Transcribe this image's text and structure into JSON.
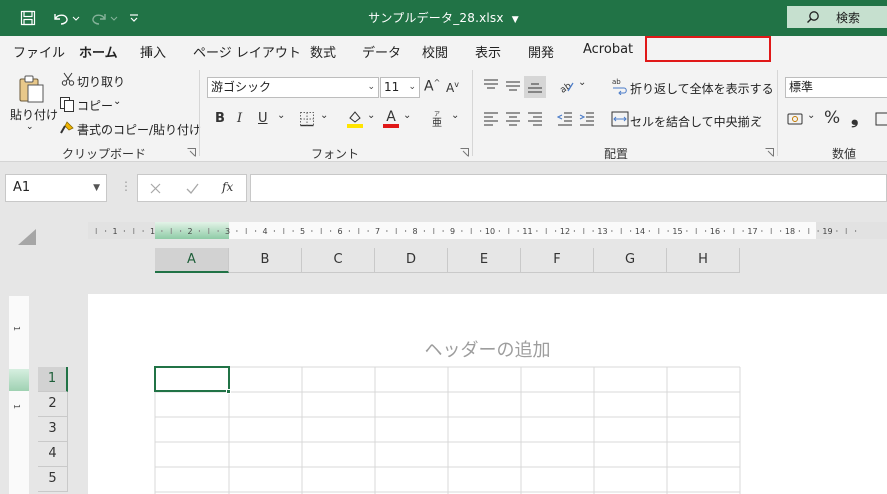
{
  "titlebar": {
    "title": "サンプルデータ_28.xlsx",
    "search_label": "検索"
  },
  "tabs": [
    "ファイル",
    "ホーム",
    "挿入",
    "ページ レイアウト",
    "数式",
    "データ",
    "校閲",
    "表示",
    "開発",
    "Acrobat"
  ],
  "active_tab": "ホーム",
  "clipboard": {
    "paste_label": "貼り付け",
    "cut_label": "切り取り",
    "copy_label": "コピー",
    "format_painter_label": "書式のコピー/貼り付け",
    "group_label": "クリップボード"
  },
  "font": {
    "font_name": "游ゴシック",
    "font_size": "11",
    "group_label": "フォント",
    "bold": "B",
    "italic": "I",
    "underline": "U",
    "font_color_glyph": "A"
  },
  "alignment": {
    "wrap_text_label": "折り返して全体を表示する",
    "merge_center_label": "セルを結合して中央揃え",
    "group_label": "配置"
  },
  "number": {
    "format_value": "標準",
    "group_label": "数値",
    "percent": "%"
  },
  "formula_bar": {
    "name_box": "A1",
    "fx": "fx",
    "content": ""
  },
  "columns": [
    "A",
    "B",
    "C",
    "D",
    "E",
    "F",
    "G",
    "H"
  ],
  "rows": [
    "1",
    "2",
    "3",
    "4",
    "5"
  ],
  "selected_cell": "A1",
  "page_header_placeholder": "ヘッダーの追加",
  "ruler_top_labels": [
    "1",
    "1",
    "2",
    "3",
    "4",
    "5",
    "6",
    "7",
    "8",
    "9",
    "10",
    "11",
    "12",
    "13",
    "14",
    "15",
    "16",
    "17",
    "18",
    "19"
  ],
  "ruler_left_labels": [
    "1",
    "1"
  ],
  "colors": {
    "brand": "#217346",
    "highlight_marker": "#ffe400",
    "font_color_marker": "#e01818",
    "annotation_box": "#e01818"
  }
}
